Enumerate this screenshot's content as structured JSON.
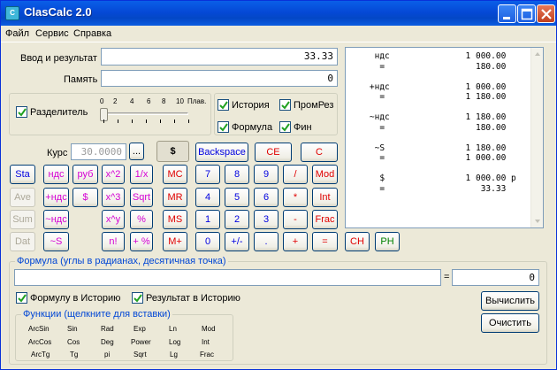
{
  "window": {
    "title": "ClasCalc  2.0",
    "icon": "calculator-icon",
    "controls": [
      "minimize-icon",
      "maximize-icon",
      "close-icon"
    ]
  },
  "menu": [
    "Файл",
    "Сервис",
    "Справка"
  ],
  "input": {
    "label": "Ввод и результат",
    "value": "33.33"
  },
  "memory": {
    "label": "Память",
    "value": "0"
  },
  "separator": {
    "label": "Разделитель",
    "checked": true,
    "scale": [
      "0",
      "2",
      "4",
      "6",
      "8",
      "10"
    ],
    "scale_suffix": "Плав.",
    "level": 0
  },
  "options": [
    {
      "label": "История",
      "checked": true
    },
    {
      "label": "ПромРез",
      "checked": true
    },
    {
      "label": "Формула",
      "checked": true
    },
    {
      "label": "Фин",
      "checked": true
    }
  ],
  "rate": {
    "label": "Курс",
    "value": "30.0000",
    "button": "...",
    "currency": "$"
  },
  "buttons": {
    "backspace": "Backspace",
    "ce": "CE",
    "c": "C",
    "sta": "Sta",
    "ave": "Ave",
    "sum": "Sum",
    "dat": "Dat",
    "nds": "ндс",
    "plus_nds": "+ндс",
    "tilde_nds": "~ндс",
    "tilde_s": "~S",
    "rub": "руб",
    "dollar": "$",
    "x2": "x^2",
    "x3": "x^3",
    "xy": "x^y",
    "fact": "n!",
    "inv": "1/x",
    "sqrt": "Sqrt",
    "pct": "%",
    "plus_pct": "+ %",
    "mc": "MC",
    "mr": "MR",
    "ms": "MS",
    "mplus": "M+",
    "d7": "7",
    "d8": "8",
    "d9": "9",
    "div": "/",
    "mod": "Mod",
    "d4": "4",
    "d5": "5",
    "d6": "6",
    "mul": "*",
    "int": "Int",
    "d1": "1",
    "d2": "2",
    "d3": "3",
    "minus": "-",
    "frac": "Frac",
    "d0": "0",
    "sign": "+/-",
    "dot": ".",
    "plus": "+",
    "eq": "=",
    "ch": "CH",
    "ph": "PH"
  },
  "history": "     ндс               1 000.00\n      =                  180.00\n\n    +ндс               1 000.00\n      =                1 180.00\n\n    ~ндс               1 180.00\n      =                  180.00\n\n     ~S                1 180.00\n      =                1 000.00\n\n      $                1 000.00 р\n      =                   33.33",
  "formula": {
    "group_title": "Формула  (углы в радианах, десятичная точка)",
    "expression": "",
    "eq_sign": "=",
    "result": "0",
    "to_history": {
      "label": "Формулу в Историю",
      "checked": true
    },
    "result_to_history": {
      "label": "Результат в Историю",
      "checked": true
    },
    "calculate": "Вычислить",
    "clear": "Очистить",
    "functions_title": "Функции (щелкните для вставки)",
    "functions": [
      [
        "ArcSin",
        "Sin",
        "Rad",
        "Exp",
        "Ln",
        "Mod"
      ],
      [
        "ArcCos",
        "Cos",
        "Deg",
        "Power",
        "Log",
        "Int"
      ],
      [
        "ArcTg",
        "Tg",
        "pi",
        "Sqrt",
        "Lg",
        "Frac"
      ]
    ]
  }
}
